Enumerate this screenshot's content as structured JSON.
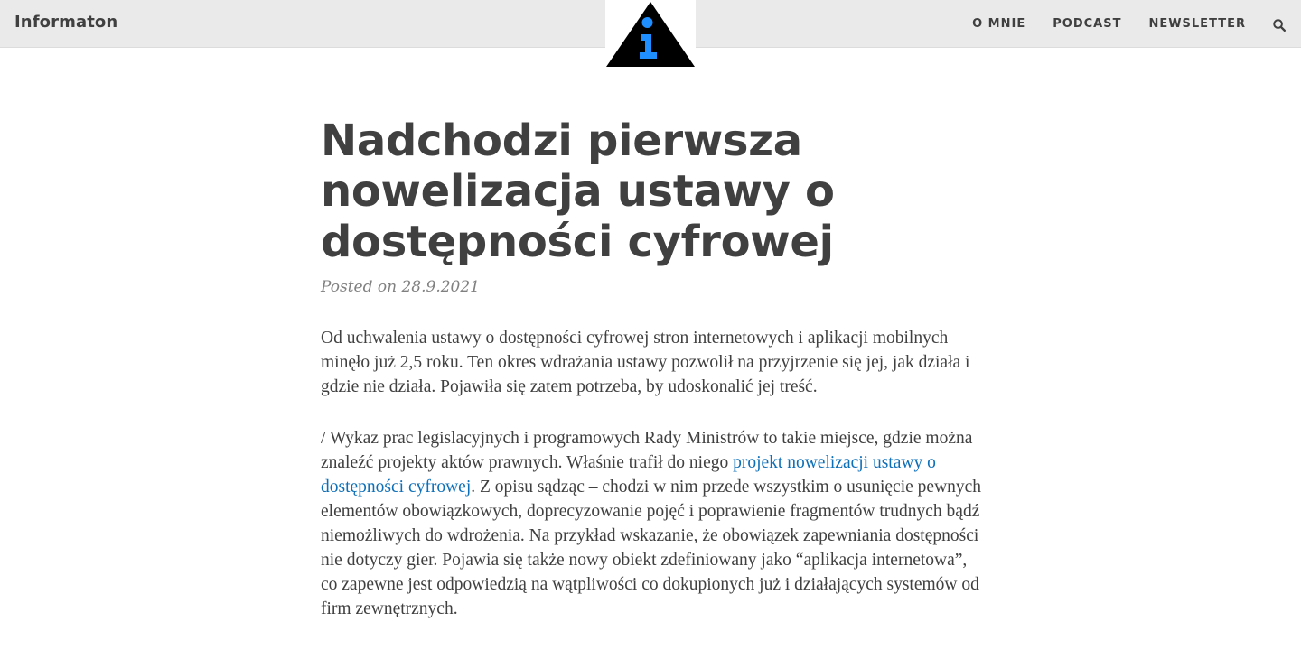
{
  "site": {
    "brand": "Informaton",
    "nav": [
      {
        "label": "O MNIE"
      },
      {
        "label": "PODCAST"
      },
      {
        "label": "NEWSLETTER"
      }
    ],
    "search_icon": "search-icon",
    "logo_icon": "info-triangle-logo"
  },
  "colors": {
    "topbar_bg": "#eaeaea",
    "text": "#404040",
    "link": "#0d6fb8",
    "logo_triangle": "#000000",
    "logo_i": "#1f8fff"
  },
  "post": {
    "title": "Nadchodzi pierwsza nowelizacja ustawy o dostępności cyfrowej",
    "meta": "Posted on 28.9.2021",
    "paragraph1": "Od uchwalenia ustawy o dostępności cyfrowej stron internetowych i aplikacji mobilnych minęło już 2,5 roku. Ten okres wdrażania ustawy pozwolił na przyjrzenie się jej, jak działa i gdzie nie działa. Pojawiła się zatem potrzeba, by udoskonalić jej treść.",
    "paragraph2_before_link": "/ Wykaz prac legislacyjnych i programowych Rady Ministrów to takie miejsce, gdzie można znaleźć projekty aktów prawnych. Właśnie trafił do niego ",
    "paragraph2_link": "projekt nowelizacji ustawy o dostępności cyfrowej",
    "paragraph2_after_link": ". Z opisu sądząc – chodzi w nim przede wszystkim o usunięcie pewnych elementów obowiązkowych, doprecyzowanie pojęć i poprawienie fragmentów trudnych bądź niemożliwych do wdrożenia. Na przykład wskazanie, że obowiązek zapewniania dostępności nie dotyczy gier. Pojawia się także nowy obiekt zdefiniowany jako “aplikacja internetowa”, co zapewne jest odpowiedzią na wątpliwości co dokupionych już i działających systemów od firm zewnętrznych."
  }
}
